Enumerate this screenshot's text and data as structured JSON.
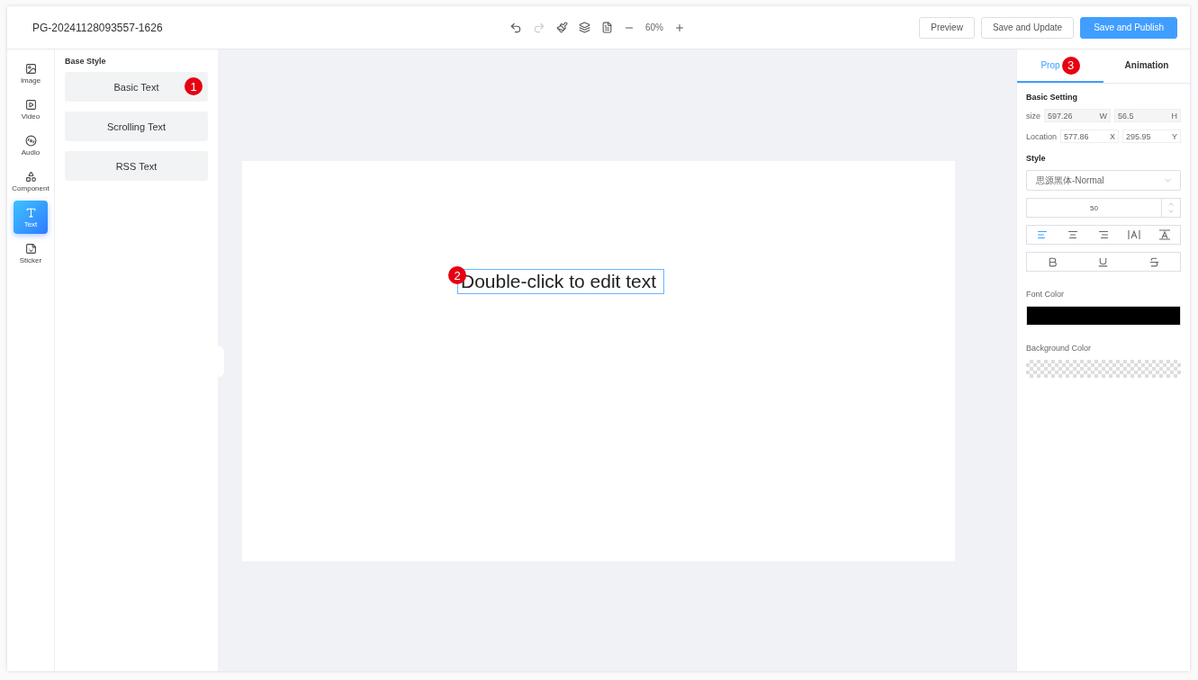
{
  "document": {
    "title": "PG-20241128093557-1626"
  },
  "toolbar": {
    "zoom": "60%"
  },
  "actions": [
    {
      "label": "Preview",
      "kind": "default"
    },
    {
      "label": "Save and Update",
      "kind": "default"
    },
    {
      "label": "Save and Publish",
      "kind": "primary"
    }
  ],
  "rail": [
    {
      "label": "Image",
      "kind": "image",
      "selected": false
    },
    {
      "label": "Video",
      "kind": "video",
      "selected": false
    },
    {
      "label": "Audio",
      "kind": "audio",
      "selected": false
    },
    {
      "label": "Component",
      "kind": "component",
      "selected": false
    },
    {
      "label": "Text",
      "kind": "text",
      "selected": true
    },
    {
      "label": "Sticker",
      "kind": "sticker",
      "selected": false
    }
  ],
  "library": {
    "heading": "Base Style",
    "items": [
      {
        "label": "Basic Text",
        "badge": "1"
      },
      {
        "label": "Scrolling Text"
      },
      {
        "label": "RSS Text"
      }
    ]
  },
  "canvas": {
    "text": "Double-click to edit text",
    "badge": "2"
  },
  "tabs": [
    {
      "label": "Prop",
      "selected": true,
      "badge": "3"
    },
    {
      "label": "Animation",
      "selected": false
    }
  ],
  "basic_setting": {
    "heading": "Basic Setting",
    "size": {
      "label": "size",
      "first": "597.26",
      "first_unit": "W",
      "second": "56.5",
      "second_unit": "H"
    },
    "location": {
      "label": "Location",
      "first": "577.86",
      "first_unit": "X",
      "second": "295.95",
      "second_unit": "Y"
    }
  },
  "style": {
    "heading": "Style",
    "font": "思源黑体-Normal",
    "font_size": "50",
    "alignment": [
      {
        "kind": "left",
        "selected": true
      },
      {
        "kind": "center",
        "selected": false
      },
      {
        "kind": "right",
        "selected": false
      },
      {
        "kind": "spacing",
        "selected": false
      },
      {
        "kind": "top",
        "selected": false
      }
    ],
    "format": [
      {
        "kind": "bold",
        "on": false
      },
      {
        "kind": "underline",
        "on": false
      },
      {
        "kind": "strike",
        "on": false
      }
    ],
    "font_color": {
      "label": "Font Color",
      "color": "#000000"
    },
    "background_color": {
      "label": "Background Color"
    }
  }
}
